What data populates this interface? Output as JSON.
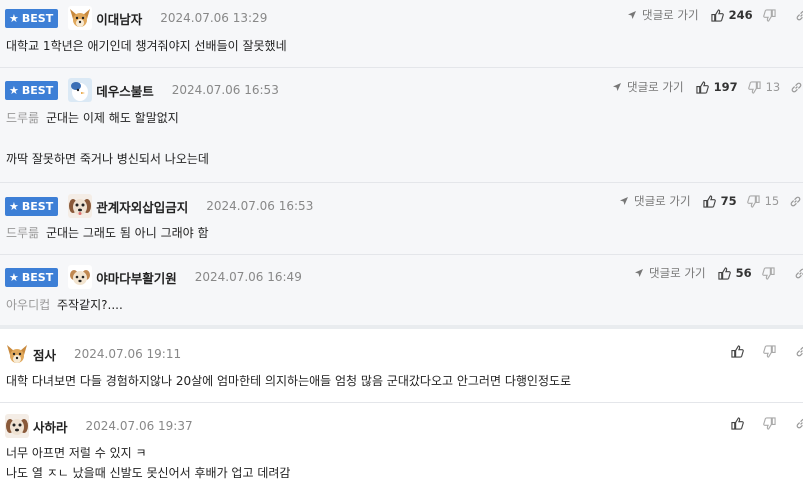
{
  "labels": {
    "best": "BEST",
    "reply": "댓글로 가기"
  },
  "comments": [
    {
      "best": true,
      "nick": "이대남자",
      "date": "2024.07.06 13:29",
      "likes": "246",
      "dislikes": "",
      "avatar_icon": "dog-face-icon",
      "lines": [
        "대학교 1학년은 애기인데 챙겨줘야지 선배들이 잘못했네"
      ]
    },
    {
      "best": true,
      "nick": "데우스불트",
      "date": "2024.07.06 16:53",
      "likes": "197",
      "dislikes": "13",
      "avatar_icon": "bird-icon",
      "mention": "드루륾",
      "lines": [
        "군대는 이제 해도 할말없지",
        "까딱 잘못하면 죽거나 병신되서 나오는데"
      ]
    },
    {
      "best": true,
      "nick": "관계자외삽입금지",
      "date": "2024.07.06 16:53",
      "likes": "75",
      "dislikes": "15",
      "avatar_icon": "puppy-icon",
      "mention": "드루륾",
      "lines": [
        "군대는 그래도 됨 아니 그래야 함"
      ]
    },
    {
      "best": true,
      "nick": "야마다부활기원",
      "date": "2024.07.06 16:49",
      "likes": "56",
      "dislikes": "",
      "avatar_icon": "dog-face-icon",
      "mention": "아우디컵",
      "lines": [
        "주작같지?...."
      ]
    },
    {
      "best": false,
      "nick": "점사",
      "date": "2024.07.06 19:11",
      "avatar_icon": "dog-face-icon",
      "lines": [
        "대학 다녀보면 다들 경험하지않나 20살에 엄마한테 의지하는애들 엄청 많음 군대갔다오고 안그러면 다행인정도로"
      ]
    },
    {
      "best": false,
      "nick": "사하라",
      "date": "2024.07.06 19:37",
      "avatar_icon": "puppy-icon",
      "lines": [
        "너무 아프면 저럴 수 있지 ㅋ",
        "나도 열 ㅈㄴ 났을때 신발도 못신어서 후배가 업고 데려감"
      ]
    }
  ],
  "colors": {
    "best_badge": "#3d7fd6",
    "best_bg": "#f6f7f9",
    "date": "#888888",
    "mention": "#999999"
  }
}
